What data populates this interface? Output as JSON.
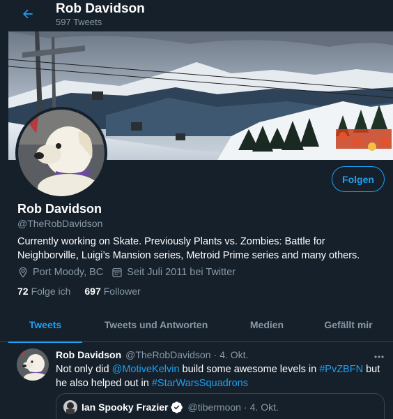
{
  "header": {
    "name": "Rob Davidson",
    "tweet_count": "597 Tweets"
  },
  "profile": {
    "name": "Rob Davidson",
    "handle": "@TheRobDavidson",
    "follow_label": "Folgen",
    "bio": "Currently working on Skate. Previously Plants vs. Zombies: Battle for Neighborville, Luigi’s Mansion series, Metroid Prime series and many others.",
    "location": "Port Moody, BC",
    "joined": "Seit Juli 2011 bei Twitter",
    "following_count": "72",
    "following_label": "Folge ich",
    "followers_count": "697",
    "followers_label": "Follower"
  },
  "tabs": [
    {
      "label": "Tweets",
      "active": true
    },
    {
      "label": "Tweets und Antworten",
      "active": false
    },
    {
      "label": "Medien",
      "active": false
    },
    {
      "label": "Gefällt mir",
      "active": false
    }
  ],
  "tweet": {
    "name": "Rob Davidson",
    "handle": "@TheRobDavidson",
    "dot": "·",
    "date": "4. Okt.",
    "text_1": "Not only did ",
    "mention": "@MotiveKelvin",
    "text_2": " build some awesome levels in ",
    "hashtag_1": "#PvZBFN",
    "text_3": " but he also helped out in ",
    "hashtag_2": "#StarWarsSquadrons",
    "quote": {
      "name": "Ian Spooky Frazier",
      "handle": "@tibermoon",
      "dot": "·",
      "date": "4. Okt."
    }
  },
  "colors": {
    "background": "#15202b",
    "accent": "#1da1f2",
    "secondary_text": "#8899a6",
    "border": "#38444d"
  },
  "icons": {
    "back": "arrow-left-icon",
    "location": "map-pin-icon",
    "calendar": "calendar-icon",
    "more": "more-horizontal-icon",
    "verified": "verified-badge-icon"
  }
}
